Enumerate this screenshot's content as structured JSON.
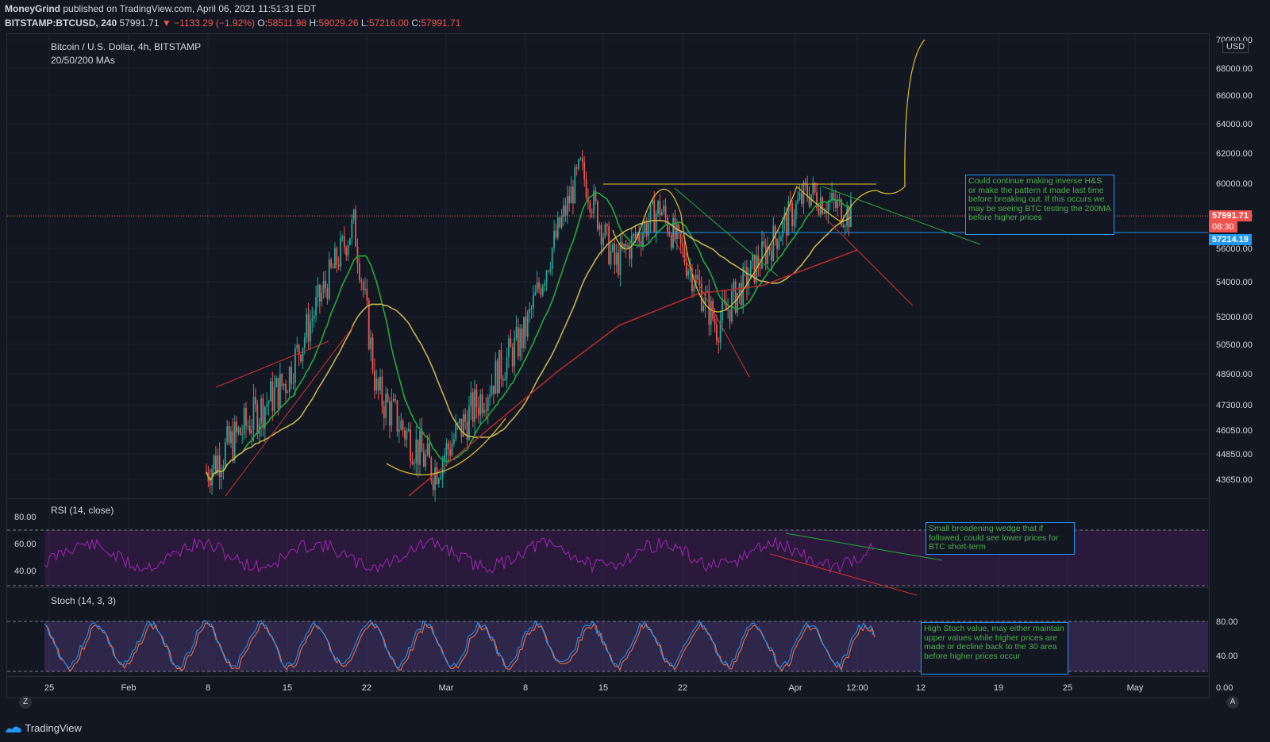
{
  "header": {
    "author": "MoneyGrind",
    "published": "published on TradingView.com, April 06, 2021 11:51:31 EDT",
    "symbol": "BITSTAMP:BTCUSD, 240",
    "last": "57991.71",
    "change": "▼ −1133.29 (−1.92%)",
    "o_label": "O:",
    "o_val": "58511.98",
    "h_label": "H:",
    "h_val": "59029.26",
    "l_label": "L:",
    "l_val": "57216.00",
    "c_label": "C:",
    "c_val": "57991.71"
  },
  "main_pane": {
    "title": "Bitcoin / U.S. Dollar, 4h, BITSTAMP",
    "subtitle": "20/50/200 MAs",
    "currency": "USD",
    "price_tag": "57991.71",
    "countdown": "08:30",
    "level_tag": "57214.19",
    "note": "Could continue making inverse H&S or make the pattern it made last time before breaking out. If this occurs we may be seeing BTC testing the 200MA before higher prices"
  },
  "rsi_pane": {
    "title": "RSI (14, close)",
    "note": "Small broadening wedge that if followed, could see lower prices for BTC short-term"
  },
  "stoch_pane": {
    "title": "Stoch (14, 3, 3)",
    "note": "High Stoch value, may either maintain upper values while higher prices are made or decline back to the 30 area before higher prices occur"
  },
  "footer": {
    "brand": "TradingView",
    "z_btn": "Z",
    "a_btn": "A"
  },
  "chart_data": {
    "type": "candlestick",
    "price_axis_ticks": [
      "70000.00",
      "68000.00",
      "66000.00",
      "64000.00",
      "62000.00",
      "60000.00",
      "58000.00",
      "56000.00",
      "54000.00",
      "52000.00",
      "50500.00",
      "48900.00",
      "47300.00",
      "46050.00",
      "44850.00",
      "43650.00"
    ],
    "rsi_axis_ticks": [
      "80.00",
      "60.00",
      "40.00"
    ],
    "stoch_axis_ticks": [
      "80.00",
      "40.00",
      "0.00"
    ],
    "time_axis_ticks": [
      "25",
      "Feb",
      "8",
      "15",
      "22",
      "Mar",
      "8",
      "15",
      "22",
      "Apr",
      "12:00",
      "12",
      "19",
      "25",
      "May"
    ],
    "series": [
      {
        "name": "MA 20",
        "color": "#22ab3b"
      },
      {
        "name": "MA 50",
        "color": "#c8b24a"
      },
      {
        "name": "MA 200",
        "color": "#b22a2a"
      }
    ],
    "close_approx": [
      {
        "date": "2021-02-08",
        "close": 44000
      },
      {
        "date": "2021-02-15",
        "close": 48500
      },
      {
        "date": "2021-02-21",
        "close": 57500
      },
      {
        "date": "2021-02-23",
        "close": 48000
      },
      {
        "date": "2021-02-28",
        "close": 44000
      },
      {
        "date": "2021-03-08",
        "close": 51000
      },
      {
        "date": "2021-03-13",
        "close": 61000
      },
      {
        "date": "2021-03-16",
        "close": 55000
      },
      {
        "date": "2021-03-20",
        "close": 58500
      },
      {
        "date": "2021-03-25",
        "close": 51500
      },
      {
        "date": "2021-04-02",
        "close": 59500
      },
      {
        "date": "2021-04-06",
        "close": 57991.71
      }
    ],
    "colors": {
      "up": "#26a69a",
      "down": "#ef5350",
      "background": "#131722",
      "rsi": "#9c27b0",
      "stoch_k": "#2196f3",
      "stoch_d": "#ff7043"
    }
  }
}
